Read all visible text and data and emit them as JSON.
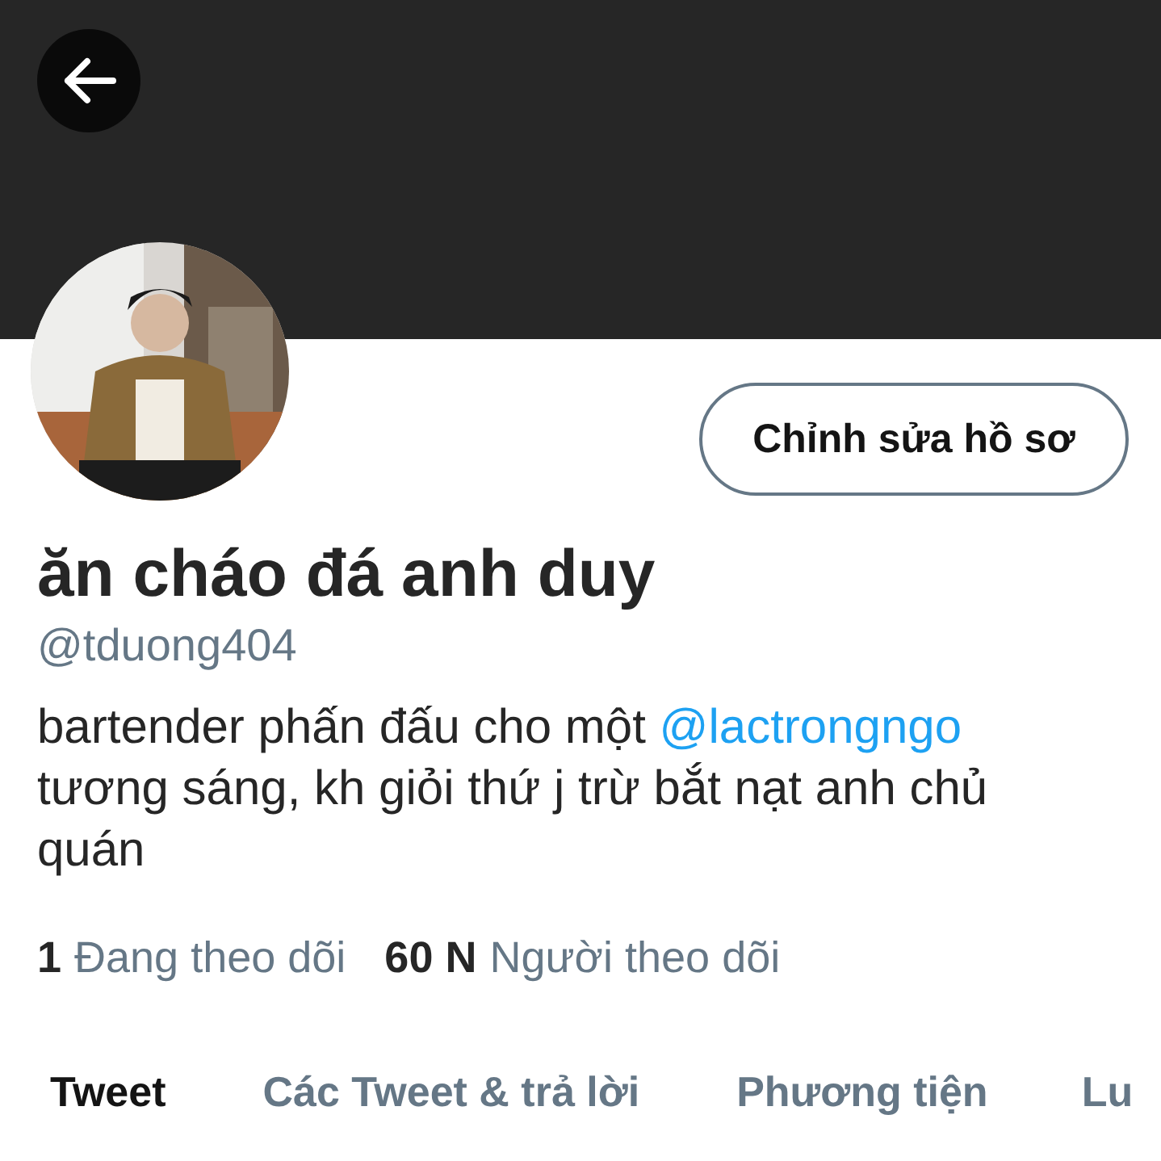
{
  "profile": {
    "edit_button": "Chỉnh sửa hồ sơ",
    "name": "ăn cháo đá anh duy",
    "handle": "@tduong404",
    "bio": {
      "text_before": "bartender phấn đấu cho một",
      "mention": "@lactrongngo",
      "text_after": "tương sáng, kh giỏi thứ j trừ bắt nạt anh chủ quán"
    },
    "stats": [
      {
        "count": "1",
        "label": "Đang theo dõi"
      },
      {
        "count": "60 N",
        "label": "Người theo dõi"
      }
    ]
  },
  "tabs": [
    {
      "label": "Tweet",
      "selected": true
    },
    {
      "label": "Các Tweet & trả lời",
      "selected": false
    },
    {
      "label": "Phương tiện",
      "selected": false
    },
    {
      "label": "Lu",
      "selected": false
    }
  ]
}
